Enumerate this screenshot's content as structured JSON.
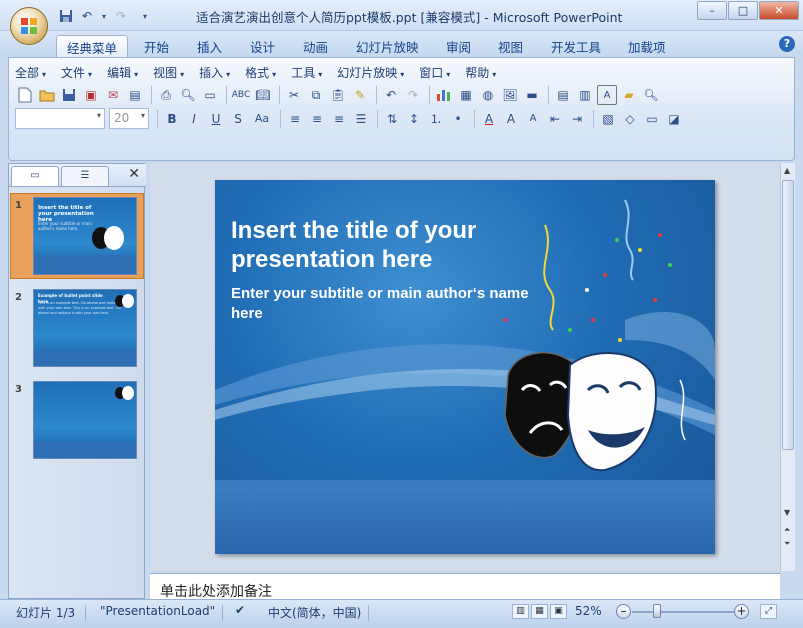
{
  "window": {
    "title": "适合演艺演出创意个人简历ppt模板.ppt [兼容模式] - Microsoft PowerPoint",
    "minimize": "–",
    "maximize": "□",
    "close": "✕"
  },
  "tabs": [
    "经典菜单",
    "开始",
    "插入",
    "设计",
    "动画",
    "幻灯片放映",
    "审阅",
    "视图",
    "开发工具",
    "加载项"
  ],
  "menu": [
    "全部",
    "文件",
    "编辑",
    "视图",
    "插入",
    "格式",
    "工具",
    "幻灯片放映",
    "窗口",
    "帮助"
  ],
  "font": {
    "name": "",
    "size": "20"
  },
  "slides_panel": {
    "tab_slides_icon": "slides-tab-icon",
    "tab_outline_icon": "outline-tab-icon",
    "close": "✕",
    "thumbnails": [
      {
        "number": "1",
        "title": "Insert the title of your presentation here",
        "subtitle": "Enter your subtitle or main author's name here"
      },
      {
        "number": "2",
        "title": "Example of bullet point slide here",
        "subtitle": "This is an example text. Go ahead and replace it with your own text. This is an example text. Go ahead and replace it with your own text."
      },
      {
        "number": "3",
        "title": "",
        "subtitle": ""
      }
    ]
  },
  "slide": {
    "title": "Insert the title of your presentation here",
    "subtitle": "Enter your subtitle or main author‘s name here"
  },
  "notes": {
    "placeholder": "单击此处添加备注"
  },
  "status": {
    "slide_counter": "幻灯片 1/3",
    "theme": "\"PresentationLoad\"",
    "language": "中文(简体，中国)",
    "zoom": "52%"
  },
  "colors": {
    "slide_bg": "#1f6cb4",
    "selected_thumb": "#e8a05a",
    "ribbon_border": "#9ab4d6"
  }
}
